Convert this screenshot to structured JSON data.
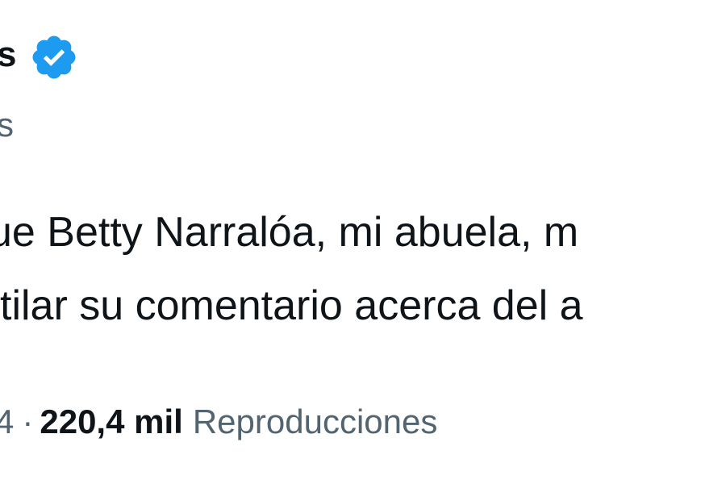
{
  "author": {
    "display_name_fragment": "s",
    "handle_fragment": "s",
    "verified_icon": "verified-badge-icon",
    "verified_color": "#1d9bf0"
  },
  "tweet": {
    "lines": [
      "ue Betty Narralóa, mi abuela, m",
      "tilar su comentario acerca del a"
    ]
  },
  "meta": {
    "date_fragment": "4",
    "separator": "·",
    "views_count": "220,4 mil",
    "views_label": "Reproducciones"
  },
  "colors": {
    "text_primary": "#0f1419",
    "text_secondary": "#536471",
    "background": "#ffffff"
  }
}
